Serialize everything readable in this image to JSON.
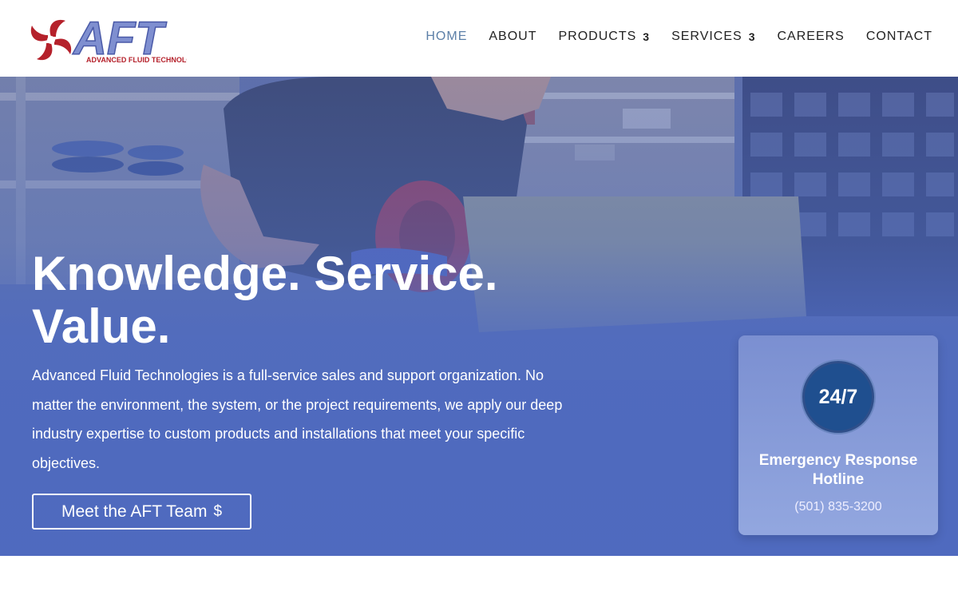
{
  "brand": {
    "logo_text": "AFT",
    "logo_subtext": "ADVANCED FLUID TECHNOLOGIES",
    "accent_red": "#b5212b",
    "accent_blue": "#4a64b5"
  },
  "nav": {
    "items": [
      {
        "label": "HOME",
        "active": true
      },
      {
        "label": "ABOUT"
      },
      {
        "label": "PRODUCTS",
        "has_dropdown": true
      },
      {
        "label": "SERVICES",
        "has_dropdown": true
      },
      {
        "label": "CAREERS"
      },
      {
        "label": "CONTACT"
      }
    ],
    "dropdown_glyph": "3"
  },
  "hero": {
    "headline_line1": "Knowledge. Service.",
    "headline_line2": "Value.",
    "intro": "Advanced Fluid Technologies is a full-service sales and support organization. No matter the environment, the system, or the project requirements, we apply our deep industry expertise to custom products and installations that meet your specific objectives.",
    "cta_label": "Meet the AFT Team",
    "cta_arrow": "$",
    "background_image": "worker-inspecting-pump-in-warehouse",
    "overlay_color": "#4e6ac0"
  },
  "hotline_card": {
    "badge": "24/7",
    "title": "Emergency Response Hotline",
    "phone": "(501) 835-3200"
  }
}
